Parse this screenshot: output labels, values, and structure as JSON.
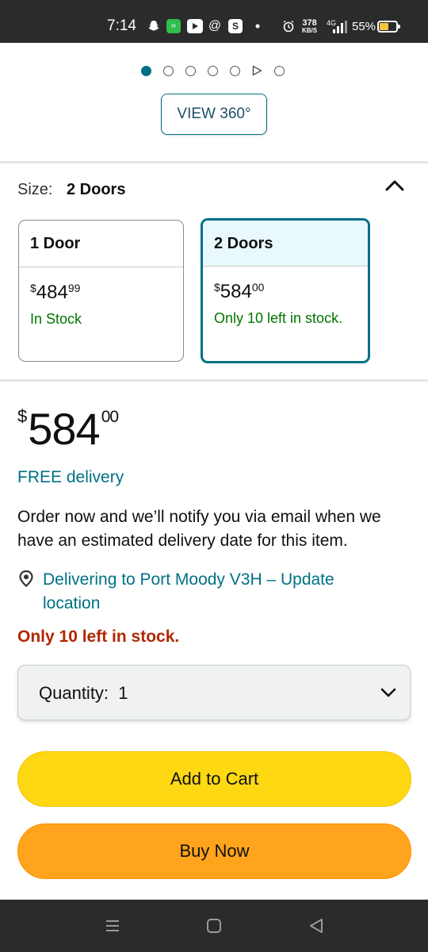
{
  "status_bar": {
    "time": "7:14",
    "speed_value": "378",
    "speed_unit": "KB/S",
    "network": "4G",
    "battery": "55%",
    "icons": [
      "snapchat-icon",
      "app-icon",
      "youtube-icon",
      "threads-icon",
      "s-app-icon",
      "dot-icon",
      "alarm-icon",
      "signal-icon",
      "battery-icon"
    ]
  },
  "carousel": {
    "dot_count": 7,
    "active_index": 0,
    "video_index": 5,
    "view360_label": "VIEW 360°"
  },
  "size": {
    "label": "Size:",
    "selected": "2 Doors",
    "options": [
      {
        "name": "1 Door",
        "price_symbol": "$",
        "price_whole": "484",
        "price_cents": "99",
        "stock": "In Stock"
      },
      {
        "name": "2 Doors",
        "price_symbol": "$",
        "price_whole": "584",
        "price_cents": "00",
        "stock": "Only 10 left in stock."
      }
    ]
  },
  "price": {
    "symbol": "$",
    "whole": "584",
    "cents": "00"
  },
  "delivery": {
    "free": "FREE delivery",
    "notice": "Order now and we’ll notify you via email when we have an estimated delivery date for this item.",
    "location": "Delivering to Port Moody V3H – Update location"
  },
  "stock_warning": "Only 10 left in stock.",
  "quantity": {
    "label": "Quantity:",
    "value": "1",
    "display": "Quantity:  1"
  },
  "buttons": {
    "add_to_cart": "Add to Cart",
    "buy_now": "Buy Now"
  },
  "colors": {
    "accent_teal": "#007185",
    "in_stock_green": "#007600",
    "low_stock_red": "#b12704",
    "add_to_cart_yellow": "#ffd814",
    "buy_now_orange": "#ffa41c"
  }
}
